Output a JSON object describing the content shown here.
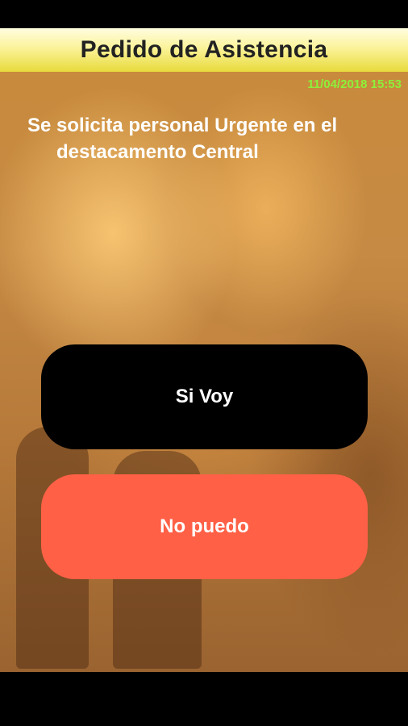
{
  "header": {
    "title": "Pedido de Asistencia"
  },
  "main": {
    "timestamp": "11/04/2018 15:53",
    "message_line1": "Se solicita personal Urgente en el",
    "message_line2": "destacamento Central"
  },
  "actions": {
    "accept_label": "Si Voy",
    "decline_label": "No puedo"
  },
  "colors": {
    "header_yellow": "#f4ec7a",
    "timestamp_green": "#8cf03a",
    "accept_button": "#000000",
    "decline_button": "#ff6046",
    "background_fire": "#c68a44"
  }
}
